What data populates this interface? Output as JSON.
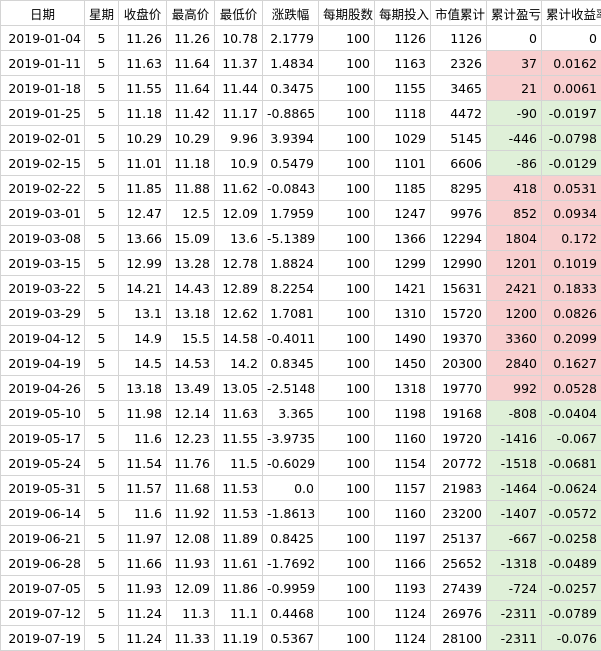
{
  "headers": [
    "日期",
    "星期",
    "收盘价",
    "最高价",
    "最低价",
    "涨跌幅",
    "每期股数",
    "每期投入",
    "市值累计",
    "累计盈亏",
    "累计收益率"
  ],
  "rows": [
    [
      "2019-01-04",
      "5",
      "11.26",
      "11.26",
      "10.78",
      "2.1779",
      "100",
      "1126",
      "1126",
      "0",
      "0"
    ],
    [
      "2019-01-11",
      "5",
      "11.63",
      "11.64",
      "11.37",
      "1.4834",
      "100",
      "1163",
      "2326",
      "37",
      "0.0162"
    ],
    [
      "2019-01-18",
      "5",
      "11.55",
      "11.64",
      "11.44",
      "0.3475",
      "100",
      "1155",
      "3465",
      "21",
      "0.0061"
    ],
    [
      "2019-01-25",
      "5",
      "11.18",
      "11.42",
      "11.17",
      "-0.8865",
      "100",
      "1118",
      "4472",
      "-90",
      "-0.0197"
    ],
    [
      "2019-02-01",
      "5",
      "10.29",
      "10.29",
      "9.96",
      "3.9394",
      "100",
      "1029",
      "5145",
      "-446",
      "-0.0798"
    ],
    [
      "2019-02-15",
      "5",
      "11.01",
      "11.18",
      "10.9",
      "0.5479",
      "100",
      "1101",
      "6606",
      "-86",
      "-0.0129"
    ],
    [
      "2019-02-22",
      "5",
      "11.85",
      "11.88",
      "11.62",
      "-0.0843",
      "100",
      "1185",
      "8295",
      "418",
      "0.0531"
    ],
    [
      "2019-03-01",
      "5",
      "12.47",
      "12.5",
      "12.09",
      "1.7959",
      "100",
      "1247",
      "9976",
      "852",
      "0.0934"
    ],
    [
      "2019-03-08",
      "5",
      "13.66",
      "15.09",
      "13.6",
      "-5.1389",
      "100",
      "1366",
      "12294",
      "1804",
      "0.172"
    ],
    [
      "2019-03-15",
      "5",
      "12.99",
      "13.28",
      "12.78",
      "1.8824",
      "100",
      "1299",
      "12990",
      "1201",
      "0.1019"
    ],
    [
      "2019-03-22",
      "5",
      "14.21",
      "14.43",
      "12.89",
      "8.2254",
      "100",
      "1421",
      "15631",
      "2421",
      "0.1833"
    ],
    [
      "2019-03-29",
      "5",
      "13.1",
      "13.18",
      "12.62",
      "1.7081",
      "100",
      "1310",
      "15720",
      "1200",
      "0.0826"
    ],
    [
      "2019-04-12",
      "5",
      "14.9",
      "15.5",
      "14.58",
      "-0.4011",
      "100",
      "1490",
      "19370",
      "3360",
      "0.2099"
    ],
    [
      "2019-04-19",
      "5",
      "14.5",
      "14.53",
      "14.2",
      "0.8345",
      "100",
      "1450",
      "20300",
      "2840",
      "0.1627"
    ],
    [
      "2019-04-26",
      "5",
      "13.18",
      "13.49",
      "13.05",
      "-2.5148",
      "100",
      "1318",
      "19770",
      "992",
      "0.0528"
    ],
    [
      "2019-05-10",
      "5",
      "11.98",
      "12.14",
      "11.63",
      "3.365",
      "100",
      "1198",
      "19168",
      "-808",
      "-0.0404"
    ],
    [
      "2019-05-17",
      "5",
      "11.6",
      "12.23",
      "11.55",
      "-3.9735",
      "100",
      "1160",
      "19720",
      "-1416",
      "-0.067"
    ],
    [
      "2019-05-24",
      "5",
      "11.54",
      "11.76",
      "11.5",
      "-0.6029",
      "100",
      "1154",
      "20772",
      "-1518",
      "-0.0681"
    ],
    [
      "2019-05-31",
      "5",
      "11.57",
      "11.68",
      "11.53",
      "0.0",
      "100",
      "1157",
      "21983",
      "-1464",
      "-0.0624"
    ],
    [
      "2019-06-14",
      "5",
      "11.6",
      "11.92",
      "11.53",
      "-1.8613",
      "100",
      "1160",
      "23200",
      "-1407",
      "-0.0572"
    ],
    [
      "2019-06-21",
      "5",
      "11.97",
      "12.08",
      "11.89",
      "0.8425",
      "100",
      "1197",
      "25137",
      "-667",
      "-0.0258"
    ],
    [
      "2019-06-28",
      "5",
      "11.66",
      "11.93",
      "11.61",
      "-1.7692",
      "100",
      "1166",
      "25652",
      "-1318",
      "-0.0489"
    ],
    [
      "2019-07-05",
      "5",
      "11.93",
      "12.09",
      "11.86",
      "-0.9959",
      "100",
      "1193",
      "27439",
      "-724",
      "-0.0257"
    ],
    [
      "2019-07-12",
      "5",
      "11.24",
      "11.3",
      "11.1",
      "0.4468",
      "100",
      "1124",
      "26976",
      "-2311",
      "-0.0789"
    ],
    [
      "2019-07-19",
      "5",
      "11.24",
      "11.33",
      "11.19",
      "0.5367",
      "100",
      "1124",
      "28100",
      "-2311",
      "-0.076"
    ]
  ],
  "colors": {
    "positive_fill": "#f8cfcf",
    "negative_fill": "#dff0d8",
    "grid": "#d4d4d4"
  }
}
